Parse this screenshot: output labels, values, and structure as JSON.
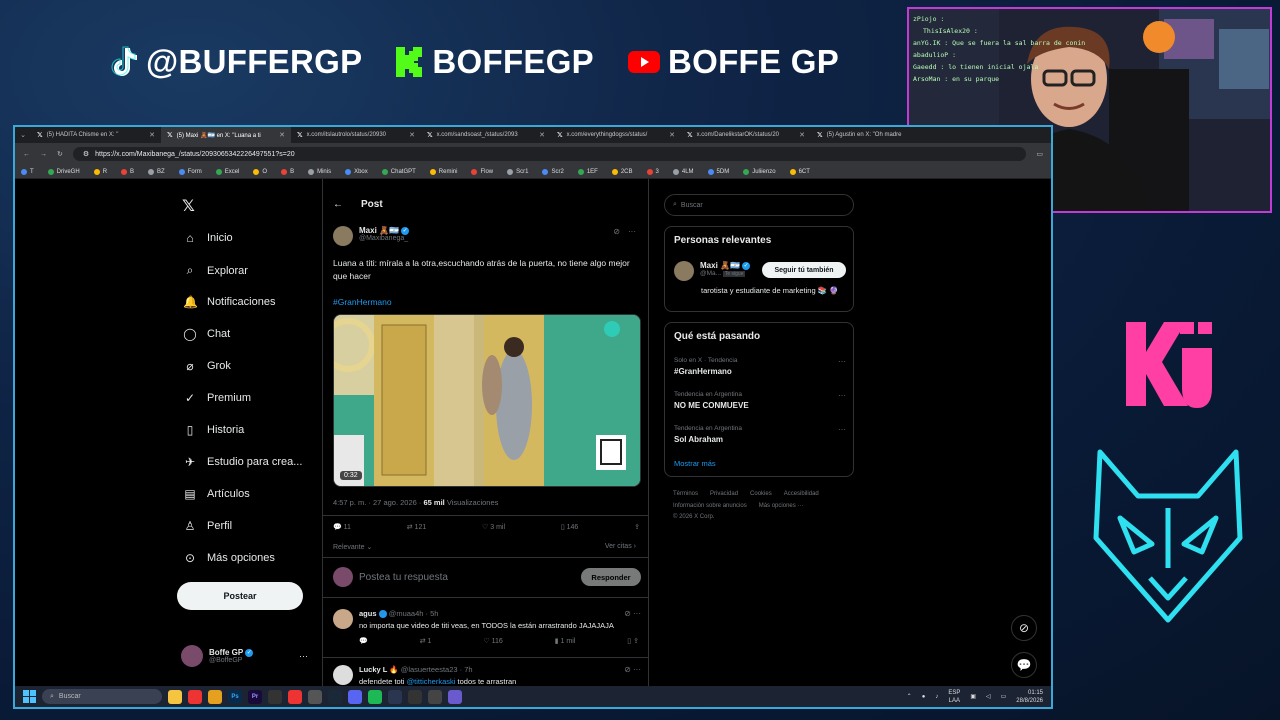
{
  "overlay": {
    "tiktok": "@BUFFERGP",
    "kick": "BOFFEGP",
    "youtube": "BOFFE GP",
    "webcam_chat": [
      "zPiojo :",
      "ThisIsAlex20 :",
      "anYG.IK : Que se fuera la sal barra de conin",
      "abadulioP :",
      "Gaeedd : lo tienen inicial ojala",
      "ArsoMan : en su parque"
    ]
  },
  "browser": {
    "tabs": [
      {
        "label": "(5) HADITA Chisme en X: \"",
        "active": false
      },
      {
        "label": "(5) Maxi 🧸🇦🇷 en X: \"Luana a ti",
        "active": true
      },
      {
        "label": "x.com/itslautrolo/status/20930",
        "active": false
      },
      {
        "label": "x.com/sandsoast_/status/2093",
        "active": false
      },
      {
        "label": "x.com/everythingdogss/status/",
        "active": false
      },
      {
        "label": "x.com/DanelikstarOK/status/20",
        "active": false
      },
      {
        "label": "(5) Agustin en X: \"Oh madre",
        "active": false
      }
    ],
    "url": "https://x.com/Maxibanega_/status/2093065342226497551?s=20",
    "bookmarks": [
      "T",
      "DriveGH",
      "R",
      "B",
      "BZ",
      "Form",
      "Excel",
      "O",
      "B",
      "Minis",
      "Xbox",
      "ChatGPT",
      "Remini",
      "Flow",
      "Scr1",
      "Scr2",
      "1EF",
      "2CB",
      "3",
      "4LM",
      "5DM",
      "Juliienzo",
      "6CT"
    ]
  },
  "nav": {
    "items": [
      "Inicio",
      "Explorar",
      "Notificaciones",
      "Chat",
      "Grok",
      "Premium",
      "Historia",
      "Estudio para crea...",
      "Artículos",
      "Perfil",
      "Más opciones"
    ],
    "post_button": "Postear",
    "account_name": "Boffe GP",
    "account_handle": "@BoffeGP"
  },
  "post": {
    "header": "Post",
    "author_name": "Maxi 🧸🇦🇷",
    "author_handle": "@Maxibanega_",
    "text": "Luana a titi: mírala a la otra,escuchando atrás de la puerta, no tiene algo mejor que hacer",
    "hashtag": "#GranHermano",
    "video_duration": "0:32",
    "timestamp": "4:57 p. m. · 27 ago. 2026 ·",
    "views_count": "65 mil",
    "views_label": "Visualizaciones",
    "replies": "11",
    "reposts": "121",
    "likes": "3 mil",
    "bookmarks": "146",
    "sort_label": "Relevante",
    "quotes_label": "Ver citas",
    "reply_placeholder": "Postea tu respuesta",
    "reply_button": "Responder"
  },
  "replies": [
    {
      "name": "agus",
      "handle": "@muaa4h · 5h",
      "text": "no importa que video de titi veas, en TODOS la están arrastrando JAJAJAJA",
      "replies": "",
      "reposts": "1",
      "likes": "116",
      "views": "1 mil"
    },
    {
      "name": "Lucky L 🔥",
      "handle": "@lasuerteesta23 · 7h",
      "text": "defendete toti",
      "mention": "@titticherkaski",
      "text_after": " todos te arrastran"
    }
  ],
  "sidebar": {
    "search_placeholder": "Buscar",
    "relevant_title": "Personas relevantes",
    "relevant_user_name": "Maxi 🧸🇦🇷",
    "relevant_user_handle": "@Ma...",
    "relevant_user_badge": "Te sigue",
    "follow_button": "Seguir tú también",
    "relevant_user_bio": "tarotista y estudiante de marketing 📚 🔮",
    "trends_title": "Qué está pasando",
    "trends": [
      {
        "context": "Solo en X · Tendencia",
        "name": "#GranHermano"
      },
      {
        "context": "Tendencia en Argentina",
        "name": "NO ME CONMUEVE"
      },
      {
        "context": "Tendencia en Argentina",
        "name": "Sol Abraham"
      }
    ],
    "show_more": "Mostrar más",
    "footer_links": [
      "Términos",
      "Privacidad",
      "Cookies",
      "Accesibilidad"
    ],
    "footer_links2": [
      "Información sobre anuncios",
      "Más opciones ···"
    ],
    "copyright": "© 2026 X Corp."
  },
  "taskbar": {
    "search": "Buscar",
    "lang": "ESP",
    "lang2": "LAA",
    "time": "01:15",
    "date": "28/8/2026"
  },
  "colors": {
    "accent": "#1d9bf0",
    "webcam_border": "#c13bd6",
    "window_border": "#3aa8d8",
    "kru_pink": "#ff3fa4",
    "fox_cyan": "#2fe0f0"
  }
}
